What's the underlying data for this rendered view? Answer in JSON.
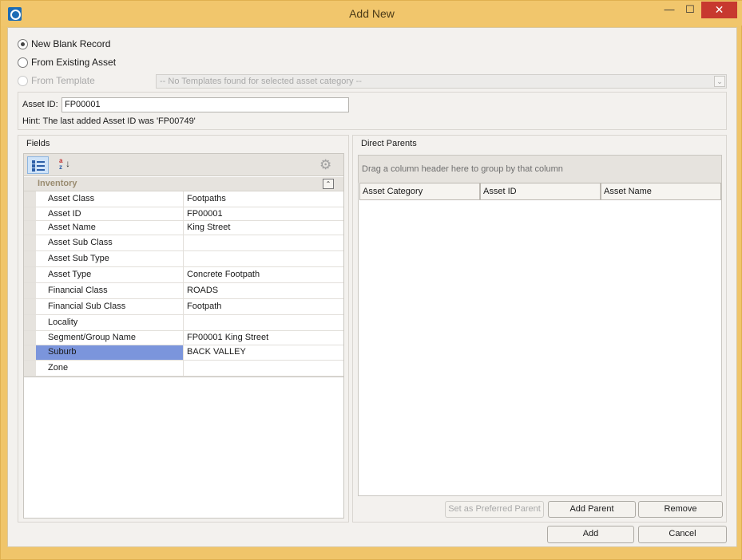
{
  "window": {
    "title": "Add New",
    "minimize_glyph": "—",
    "maximize_glyph": "☐",
    "close_glyph": "✕"
  },
  "record_source": {
    "options": [
      {
        "label": "New Blank Record",
        "checked": true,
        "enabled": true
      },
      {
        "label": "From Existing Asset",
        "checked": false,
        "enabled": true
      },
      {
        "label": "From Template",
        "checked": false,
        "enabled": false
      }
    ],
    "template_placeholder": "-- No Templates found for selected asset category --"
  },
  "asset_id": {
    "label": "Asset ID:",
    "value": "FP00001",
    "hint": "Hint: The last added Asset ID was 'FP00749'"
  },
  "fields": {
    "title": "Fields",
    "toolbar": {
      "categorized_icon": "categorized-view-icon",
      "sort_a": "a",
      "sort_z": "z",
      "sort_arrow": "↓",
      "settings_icon": "gear-icon"
    },
    "category": "Inventory",
    "collapse_glyph": "⌃",
    "rows": [
      {
        "name": "Asset Class",
        "value": "Footpaths"
      },
      {
        "name": "Asset ID",
        "value": "FP00001"
      },
      {
        "name": "Asset Name",
        "value": "King Street"
      },
      {
        "name": "Asset Sub Class",
        "value": ""
      },
      {
        "name": "Asset Sub Type",
        "value": ""
      },
      {
        "name": "Asset Type",
        "value": "Concrete Footpath"
      },
      {
        "name": "Financial Class",
        "value": "ROADS"
      },
      {
        "name": "Financial Sub Class",
        "value": "Footpath"
      },
      {
        "name": "Locality",
        "value": ""
      },
      {
        "name": "Segment/Group Name",
        "value": "FP00001 King Street"
      },
      {
        "name": "Suburb",
        "value": "BACK VALLEY"
      },
      {
        "name": "Zone",
        "value": ""
      }
    ],
    "selected_row": "Suburb"
  },
  "direct_parents": {
    "title": "Direct Parents",
    "group_hint": "Drag a column header here to group by that column",
    "columns": [
      "Asset Category",
      "Asset ID",
      "Asset Name"
    ],
    "buttons": {
      "set_preferred": "Set as Preferred Parent",
      "add_parent": "Add Parent",
      "remove": "Remove"
    }
  },
  "footer": {
    "add": "Add",
    "cancel": "Cancel"
  },
  "colors": {
    "title_bar": "#f1c66c",
    "close_button": "#c7392f",
    "selection": "#7b95dc"
  }
}
